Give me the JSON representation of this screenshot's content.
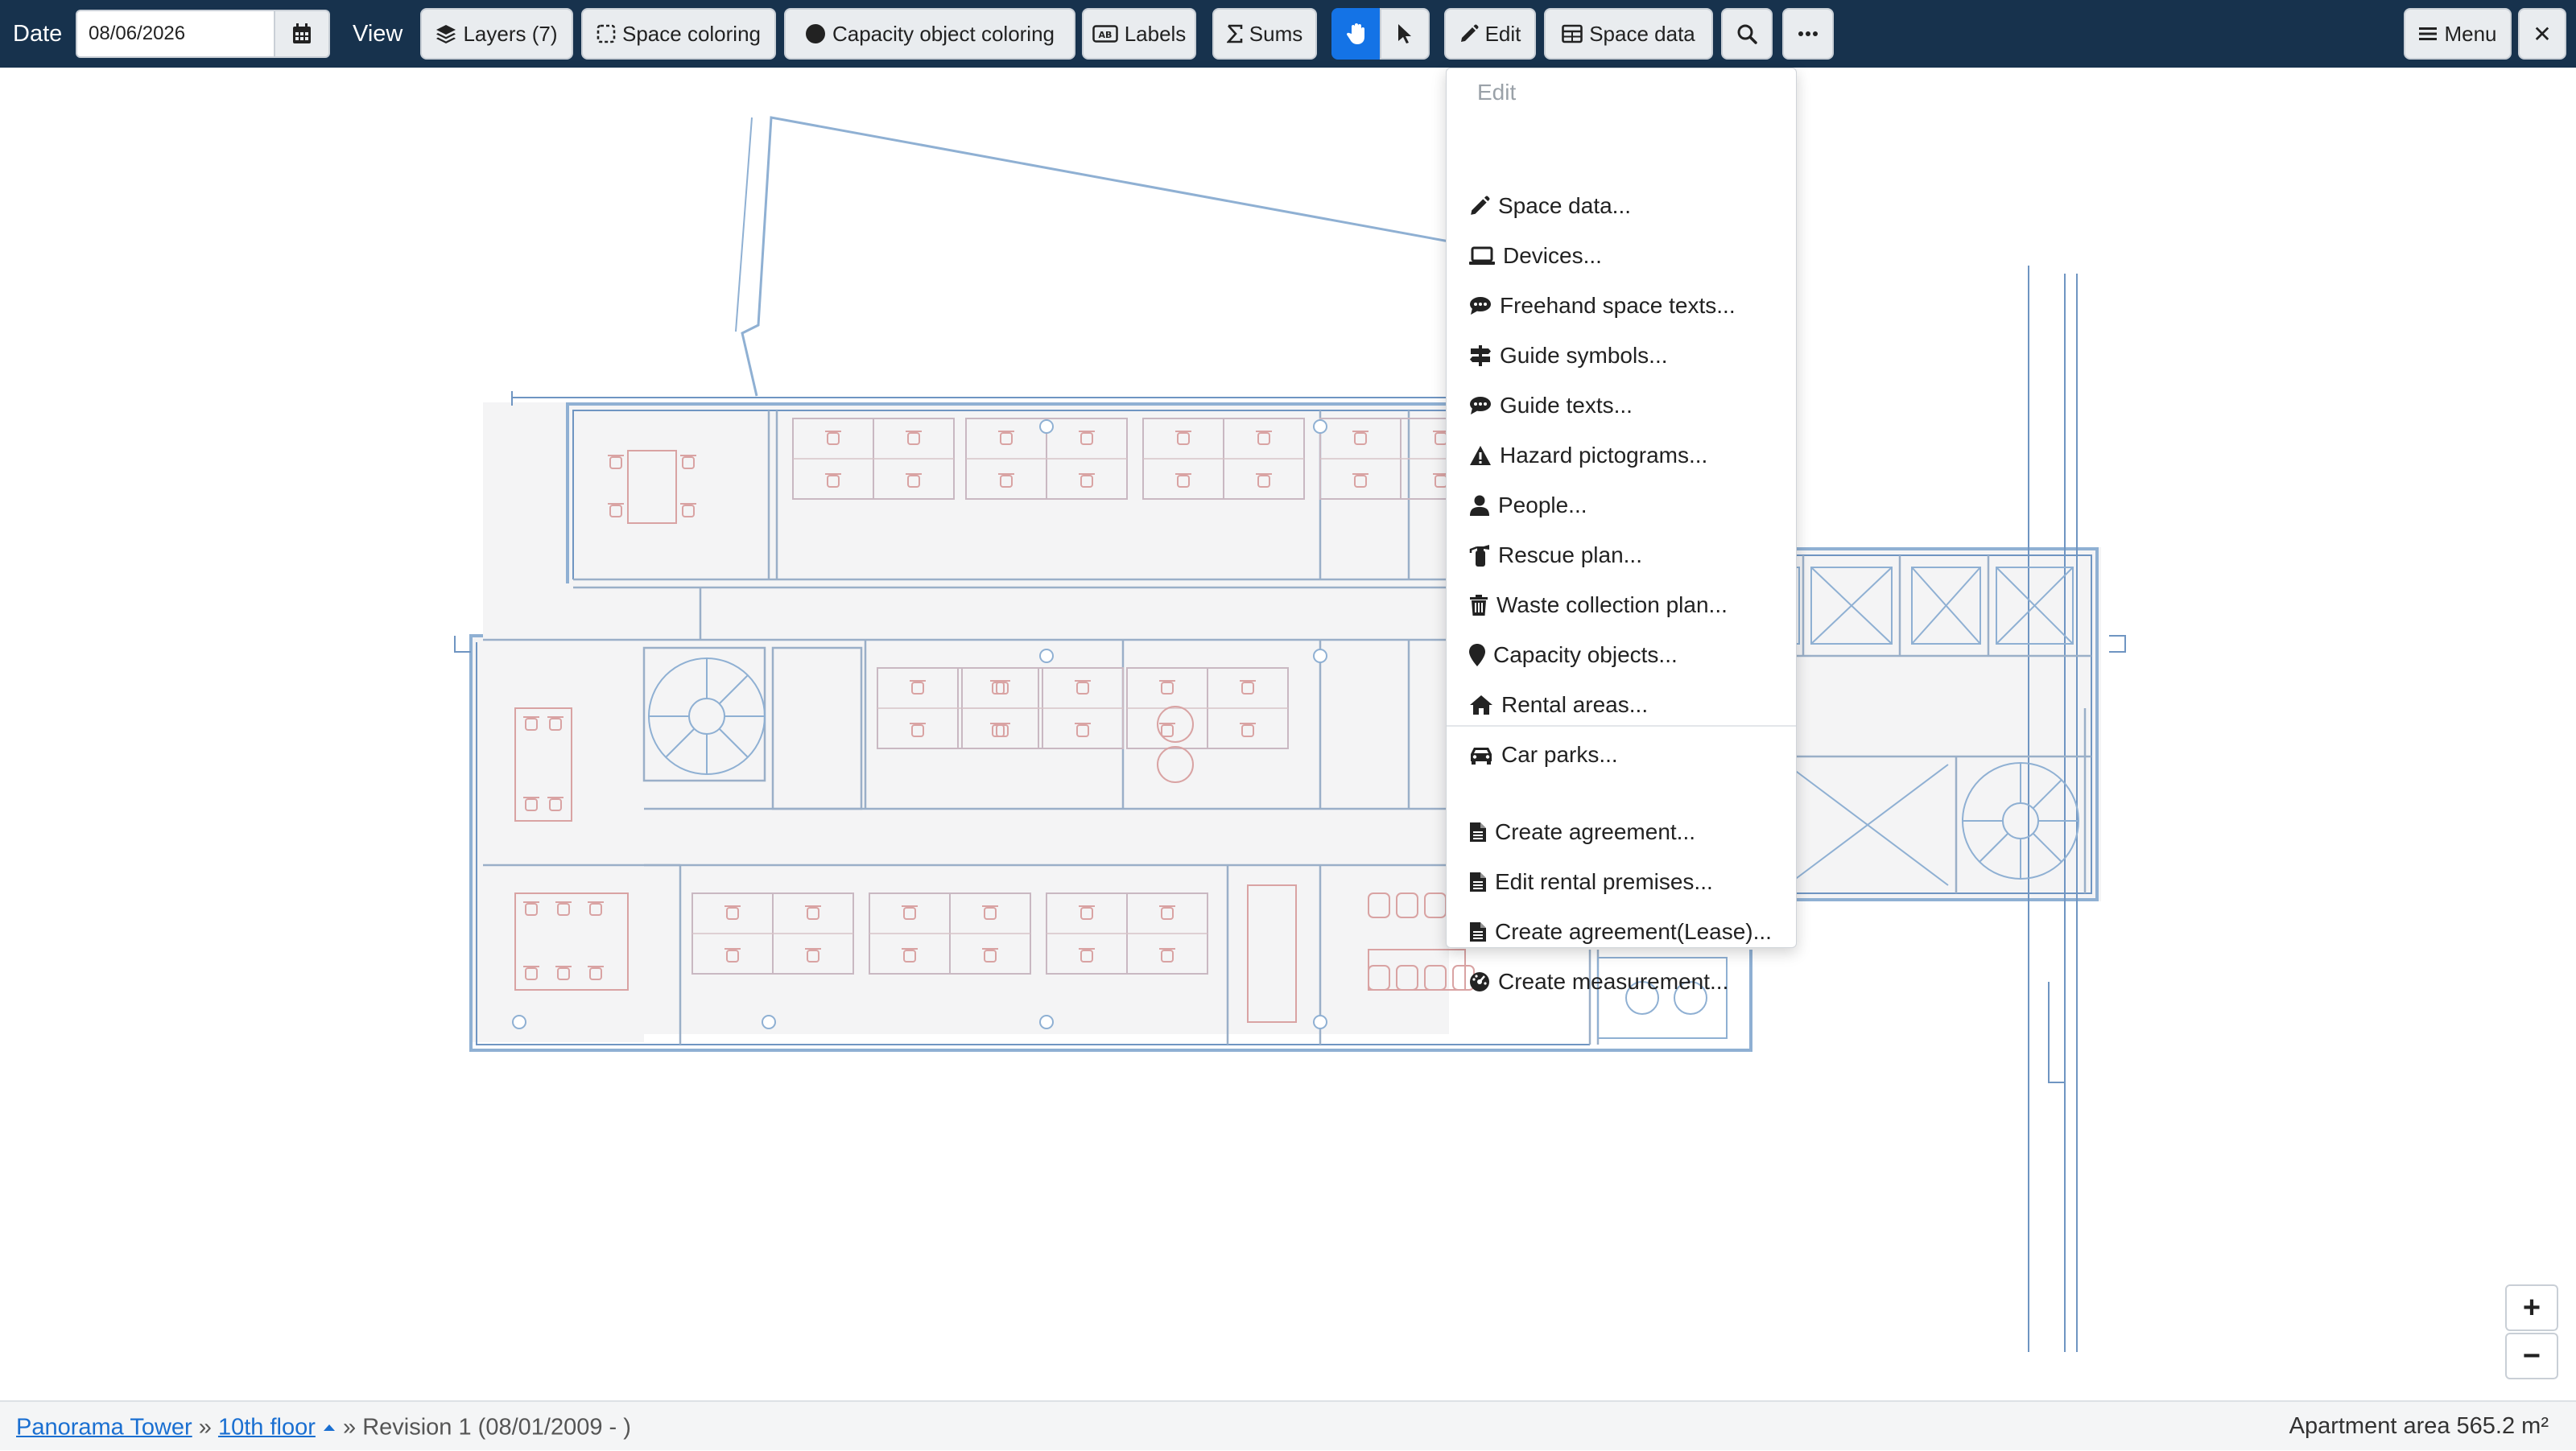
{
  "toolbar": {
    "date_label": "Date",
    "date_value": "08/06/2026",
    "view_label": "View",
    "layers_label": "Layers (7)",
    "space_coloring_label": "Space coloring",
    "capacity_coloring_label": "Capacity object coloring",
    "labels_label": "Labels",
    "sums_label": "Sums",
    "edit_label": "Edit",
    "space_data_label": "Space data",
    "menu_label": "Menu",
    "close_glyph": "✕"
  },
  "edit_menu": {
    "header": "Edit",
    "items": [
      {
        "label": "Space data...",
        "icon": "pencil-icon"
      },
      {
        "label": "Devices...",
        "icon": "laptop-icon"
      },
      {
        "label": "Freehand space texts...",
        "icon": "comment-icon"
      },
      {
        "label": "Guide symbols...",
        "icon": "signpost-icon"
      },
      {
        "label": "Guide texts...",
        "icon": "comment-icon"
      },
      {
        "label": "Hazard pictograms...",
        "icon": "warning-icon"
      },
      {
        "label": "People...",
        "icon": "user-icon"
      },
      {
        "label": "Rescue plan...",
        "icon": "fire-extinguisher-icon"
      },
      {
        "label": "Waste collection plan...",
        "icon": "trash-icon"
      },
      {
        "label": "Capacity objects...",
        "icon": "map-marker-icon"
      },
      {
        "label": "Rental areas...",
        "icon": "home-icon"
      },
      {
        "label": "Car parks...",
        "icon": "car-icon"
      }
    ],
    "items2": [
      {
        "label": "Create agreement...",
        "icon": "file-icon"
      },
      {
        "label": "Edit rental premises...",
        "icon": "file-icon"
      },
      {
        "label": "Create agreement(Lease)...",
        "icon": "file-icon"
      },
      {
        "label": "Create measurement...",
        "icon": "gauge-icon"
      }
    ]
  },
  "zoom": {
    "in": "+",
    "out": "−"
  },
  "status": {
    "building": "Panorama Tower",
    "sep": "»",
    "floor": "10th floor",
    "revision": "» Revision 1 (08/01/2009 - )",
    "area": "Apartment area 565.2 m²"
  },
  "colors": {
    "toolbar_bg": "#17324d",
    "active_blue": "#1473e6",
    "plan_line": "#8fb0d3",
    "furniture": "#d9a3a3",
    "link": "#1a6fd1"
  }
}
